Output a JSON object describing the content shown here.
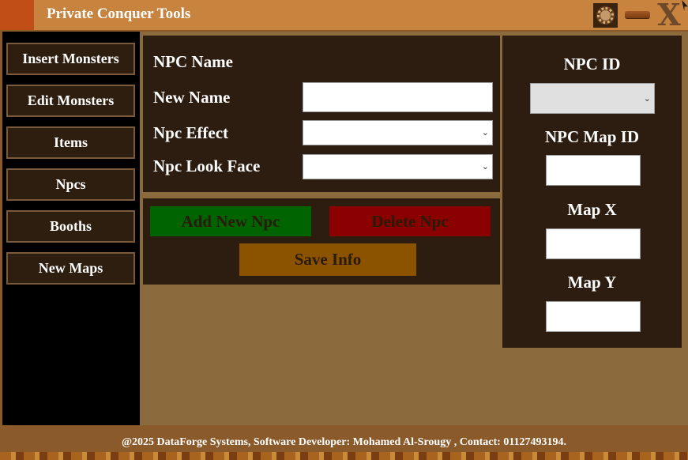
{
  "window": {
    "title": "Private Conquer Tools",
    "icons": [
      "settings-icon",
      "minimize-icon",
      "close-icon"
    ],
    "close_glyph": "X"
  },
  "sidebar": {
    "items": [
      {
        "label": "Insert Monsters"
      },
      {
        "label": "Edit Monsters"
      },
      {
        "label": "Items"
      },
      {
        "label": "Npcs"
      },
      {
        "label": "Booths"
      },
      {
        "label": "New Maps"
      }
    ]
  },
  "npc_form": {
    "section_label": "NPC Name",
    "new_name_label": "New Name",
    "new_name_value": "",
    "effect_label": "Npc Effect",
    "effect_value": "",
    "lookface_label": "Npc Look Face",
    "lookface_value": ""
  },
  "actions": {
    "add_label": "Add New Npc",
    "delete_label": "Delete Npc",
    "save_label": "Save Info"
  },
  "id_panel": {
    "npc_id_label": "NPC ID",
    "npc_id_value": "",
    "map_id_label": "NPC Map ID",
    "map_id_value": "",
    "map_x_label": "Map X",
    "map_x_value": "",
    "map_y_label": "Map Y",
    "map_y_value": ""
  },
  "footer": {
    "text": "@2025 DataForge Systems, Software Developer: Mohamed Al-Srougy , Contact: 01127493194."
  },
  "colors": {
    "titlebar": "#c8843f",
    "panel": "#2c1d10",
    "add_button": "#006400",
    "delete_button": "#8b0000",
    "save_button": "#8b5200",
    "button_text": "#2a1a0a"
  }
}
